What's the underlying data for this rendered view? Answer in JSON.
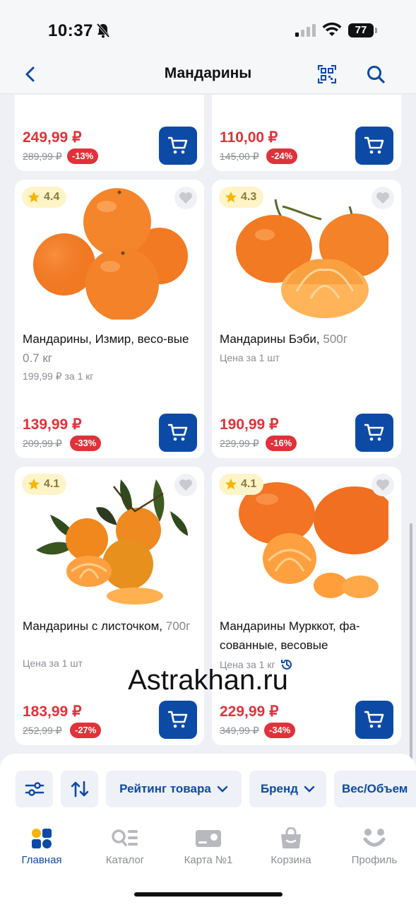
{
  "status": {
    "time": "10:37",
    "battery": "77"
  },
  "header": {
    "title": "Мандарины"
  },
  "cards_top": [
    {
      "price": "249,99 ₽",
      "old_price": "289,99 ₽",
      "discount": "-13%"
    },
    {
      "price": "110,00 ₽",
      "old_price": "145,00 ₽",
      "discount": "-24%"
    }
  ],
  "products": [
    {
      "rating": "4.4",
      "name": "Мандарины, Измир, весо-вые",
      "weight": "0.7 кг",
      "sub": "199,99 ₽ за 1 кг",
      "price": "139,99 ₽",
      "old_price": "209,99 ₽",
      "discount": "-33%"
    },
    {
      "rating": "4.3",
      "name": "Мандарины Бэби,",
      "weight": "500г",
      "sub": "Цена за 1 шт",
      "price": "190,99 ₽",
      "old_price": "229,99 ₽",
      "discount": "-16%"
    },
    {
      "rating": "4.1",
      "name": "Мандарины с листочком,",
      "weight": "700г",
      "sub": "Цена за 1 шт",
      "price": "183,99 ₽",
      "old_price": "252,99 ₽",
      "discount": "-27%"
    },
    {
      "rating": "4.1",
      "name": "Мандарины Мурккот, фа-сованные, весовые",
      "weight": "",
      "sub": "Цена за 1 кг",
      "price": "229,99 ₽",
      "old_price": "349,99 ₽",
      "discount": "-34%"
    }
  ],
  "watermark": "Astrakhan.ru",
  "filters": {
    "rating": "Рейтинг товара",
    "brand": "Бренд",
    "volume": "Вес/Объем"
  },
  "tabs": [
    {
      "label": "Главная",
      "icon": "home-icon"
    },
    {
      "label": "Каталог",
      "icon": "catalog-icon"
    },
    {
      "label": "Карта №1",
      "icon": "card-icon"
    },
    {
      "label": "Корзина",
      "icon": "basket-icon"
    },
    {
      "label": "Профиль",
      "icon": "profile-icon"
    }
  ],
  "colors": {
    "accent": "#0c4aa6",
    "sale": "#e0323a",
    "rating_bg": "#fff4c8"
  }
}
